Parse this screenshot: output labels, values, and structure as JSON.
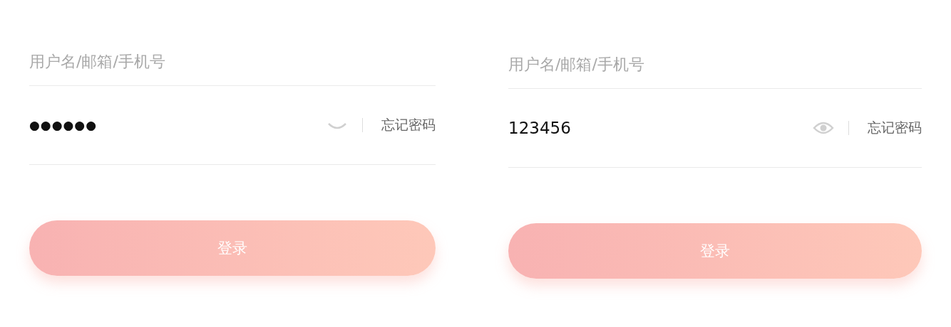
{
  "forms": [
    {
      "username": {
        "placeholder": "用户名/邮箱/手机号"
      },
      "password": {
        "value": "●●●●●●",
        "visible": false
      },
      "forgot_link": "忘记密码",
      "login_button": "登录"
    },
    {
      "username": {
        "placeholder": "用户名/邮箱/手机号"
      },
      "password": {
        "value": "123456",
        "visible": true
      },
      "forgot_link": "忘记密码",
      "login_button": "登录"
    }
  ]
}
